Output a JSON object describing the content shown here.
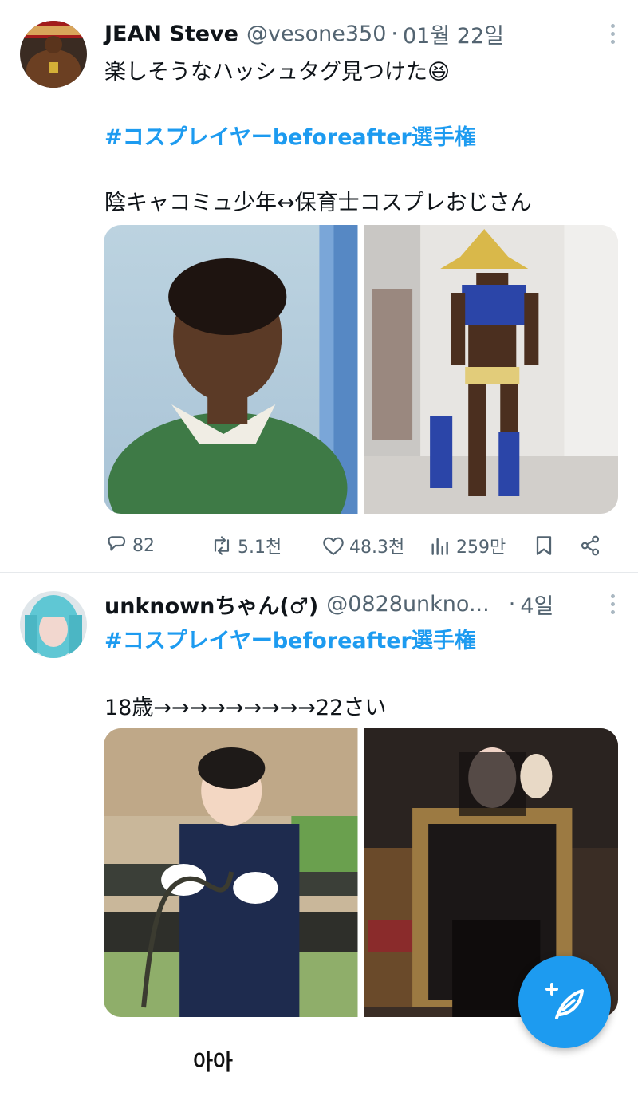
{
  "tweets": [
    {
      "name": "JEAN Steve",
      "handle": "@vesone350",
      "date": "01월 22일",
      "text_line1": "楽しそうなハッシュタグ見つけた😆",
      "hashtag": "#コスプレイヤーbeforeafter選手権",
      "text_line3": "陰キャコミュ少年↔保育士コスプレおじさん",
      "stats": {
        "replies": "82",
        "retweets": "5.1천",
        "likes": "48.3천",
        "views": "259만"
      }
    },
    {
      "name": "unknownちゃん(♂)",
      "handle": "@0828unkno...",
      "date": "4일",
      "hashtag": "#コスプレイヤーbeforeafter選手権",
      "text_line2": "18歳→→→→→→→→→22さい"
    }
  ],
  "caption": "아아",
  "icons": {
    "reply": "speech-bubble-icon",
    "retweet": "retweet-icon",
    "like": "heart-icon",
    "views": "bar-chart-icon",
    "bookmark": "bookmark-icon",
    "share": "share-icon",
    "compose": "feather-plus-icon",
    "more": "more-vertical-icon"
  },
  "colors": {
    "accent": "#1d9bf0",
    "secondary_text": "#536471",
    "primary_text": "#0f1419"
  }
}
